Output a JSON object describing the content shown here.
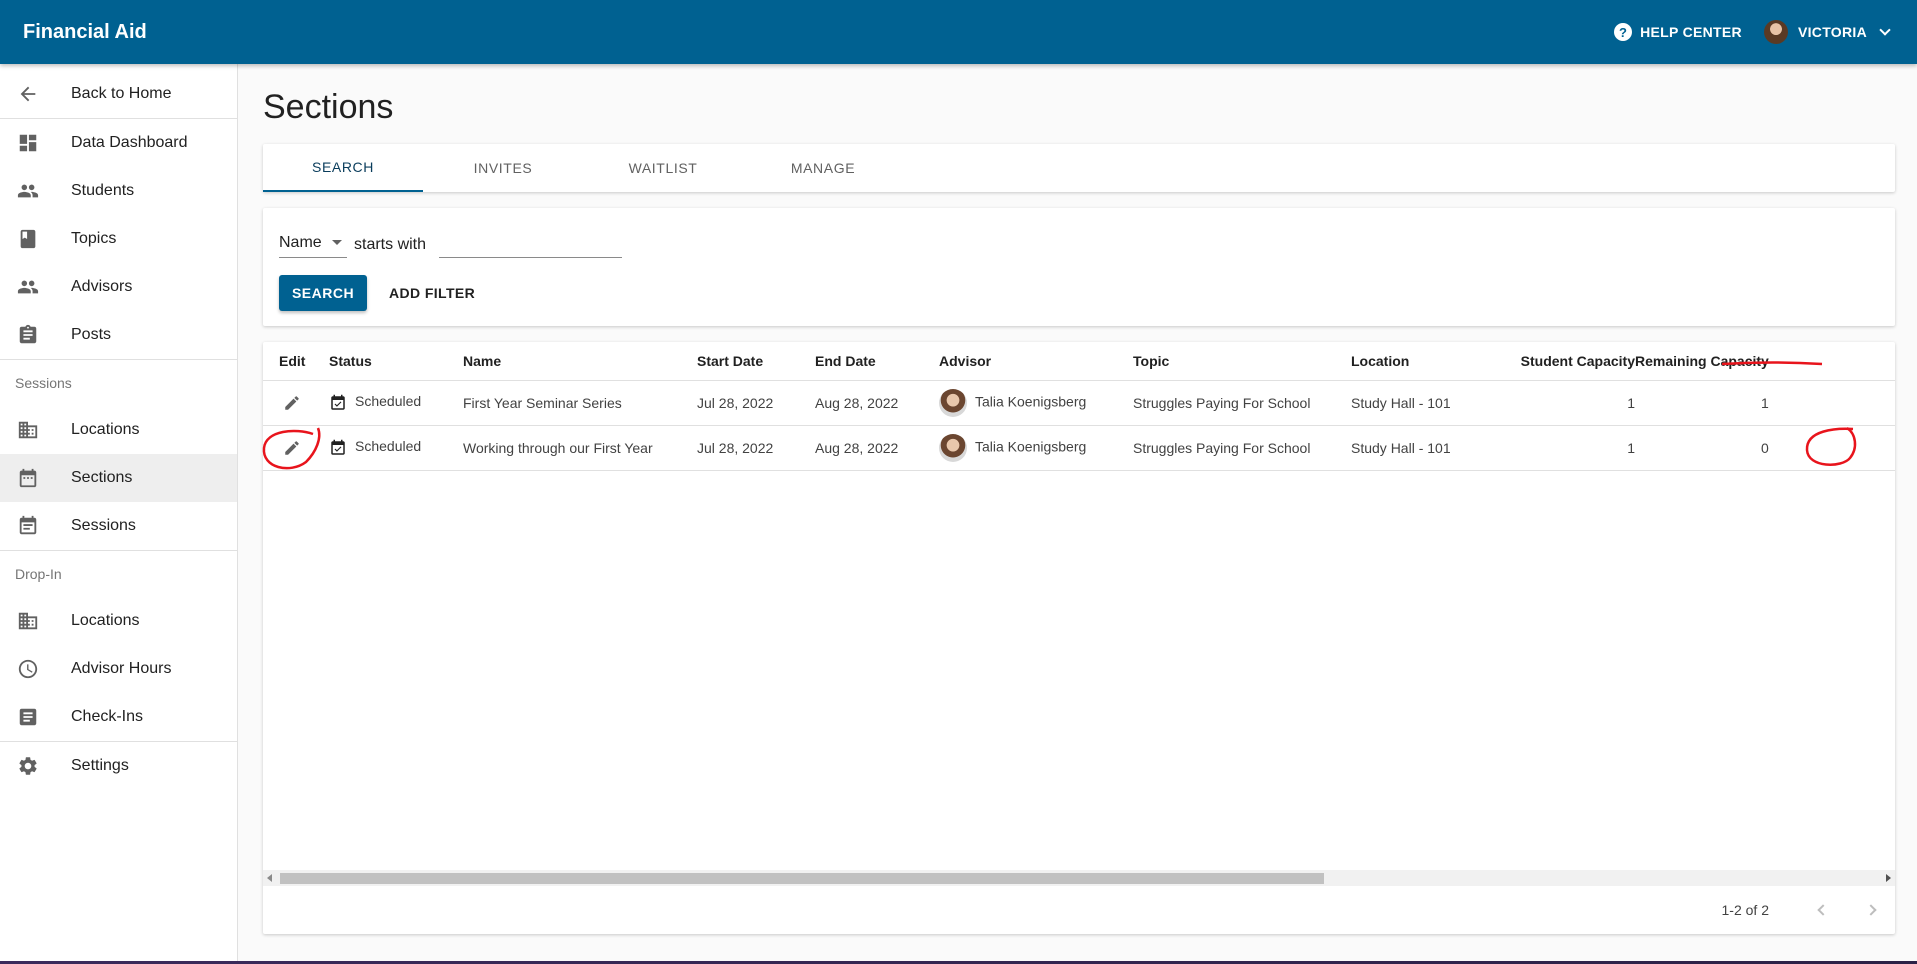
{
  "app": {
    "title": "Financial Aid"
  },
  "header": {
    "help_label": "HELP CENTER",
    "user_name": "VICTORIA"
  },
  "sidebar": {
    "back": "Back to Home",
    "items_top": [
      {
        "label": "Data Dashboard",
        "icon": "dashboard-icon"
      },
      {
        "label": "Students",
        "icon": "people-icon"
      },
      {
        "label": "Topics",
        "icon": "book-icon"
      },
      {
        "label": "Advisors",
        "icon": "people-icon"
      },
      {
        "label": "Posts",
        "icon": "clipboard-icon"
      }
    ],
    "section_sessions": "Sessions",
    "items_sessions": [
      {
        "label": "Locations",
        "icon": "building-icon"
      },
      {
        "label": "Sections",
        "icon": "calendar-icon"
      },
      {
        "label": "Sessions",
        "icon": "event-note-icon"
      }
    ],
    "section_dropin": "Drop-In",
    "items_dropin": [
      {
        "label": "Locations",
        "icon": "building-icon"
      },
      {
        "label": "Advisor Hours",
        "icon": "clock-icon"
      },
      {
        "label": "Check-Ins",
        "icon": "list-icon"
      }
    ],
    "settings": "Settings"
  },
  "page": {
    "title": "Sections"
  },
  "tabs": [
    "SEARCH",
    "INVITES",
    "WAITLIST",
    "MANAGE"
  ],
  "filter": {
    "field": "Name",
    "operator": "starts with",
    "value": "",
    "search_label": "SEARCH",
    "add_filter_label": "ADD FILTER"
  },
  "table": {
    "columns": [
      "Edit",
      "Status",
      "Name",
      "Start Date",
      "End Date",
      "Advisor",
      "Topic",
      "Location",
      "Student Capacity",
      "Remaining Capacity"
    ],
    "rows": [
      {
        "status": "Scheduled",
        "name": "First Year Seminar Series",
        "start": "Jul 28, 2022",
        "end": "Aug 28, 2022",
        "advisor": "Talia Koenigsberg",
        "topic": "Struggles Paying For School",
        "location": "Study Hall - 101",
        "student_capacity": "1",
        "remaining_capacity": "1"
      },
      {
        "status": "Scheduled",
        "name": "Working through our First Year",
        "start": "Jul 28, 2022",
        "end": "Aug 28, 2022",
        "advisor": "Talia Koenigsberg",
        "topic": "Struggles Paying For School",
        "location": "Study Hall - 101",
        "student_capacity": "1",
        "remaining_capacity": "0"
      }
    ]
  },
  "pagination": {
    "range": "1-2 of 2"
  },
  "colors": {
    "primary": "#006191",
    "annotation": "#e8141c"
  }
}
